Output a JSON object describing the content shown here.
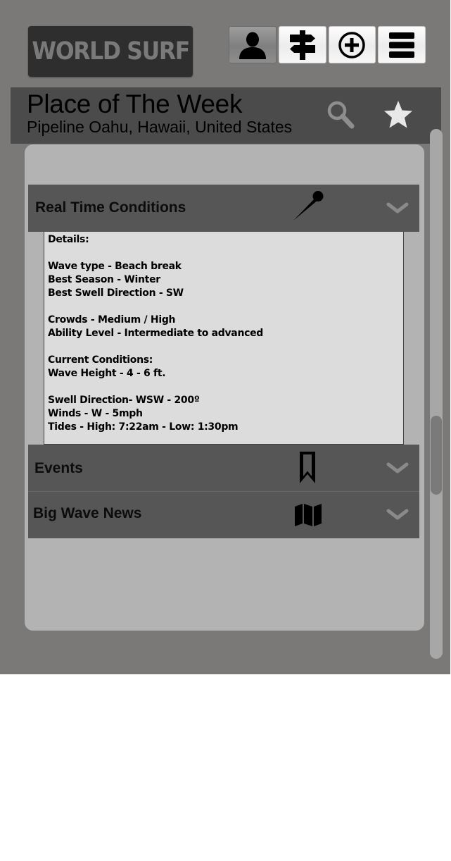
{
  "app": {
    "logo_text": "WORLD SURF"
  },
  "toolbar": {
    "buttons": [
      {
        "icon": "user-icon",
        "active": true
      },
      {
        "icon": "signpost-icon",
        "active": false
      },
      {
        "icon": "plus-circle-icon",
        "active": false
      },
      {
        "icon": "menu-icon",
        "active": false
      }
    ]
  },
  "header": {
    "title": "Place of The Week",
    "subtitle": "Pipeline Oahu, Hawaii, United States",
    "icons": [
      "search-icon",
      "star-icon"
    ]
  },
  "sections": [
    {
      "label": "Real Time Conditions",
      "icon": "pin-icon",
      "expanded": true,
      "details": [
        "Details:",
        "",
        "Wave type - Beach break",
        "Best Season - Winter",
        "Best Swell Direction - SW",
        "",
        "Crowds - Medium / High",
        "Ability Level - Intermediate to advanced",
        "",
        "Current Conditions:",
        "Wave Height - 4 - 6 ft.",
        "",
        "Swell Direction- WSW - 200º",
        "Winds - W - 5mph",
        "Tides - High: 7:22am -  Low: 1:30pm"
      ]
    },
    {
      "label": "Events",
      "icon": "bookmark-icon",
      "expanded": false
    },
    {
      "label": "Big Wave News",
      "icon": "map-icon",
      "expanded": false
    }
  ],
  "colors": {
    "background": "#7a7978",
    "header": "#4c4b4b",
    "panel": "#b3b3b3",
    "accordion": "#575656",
    "details": "#dcdcdc"
  }
}
